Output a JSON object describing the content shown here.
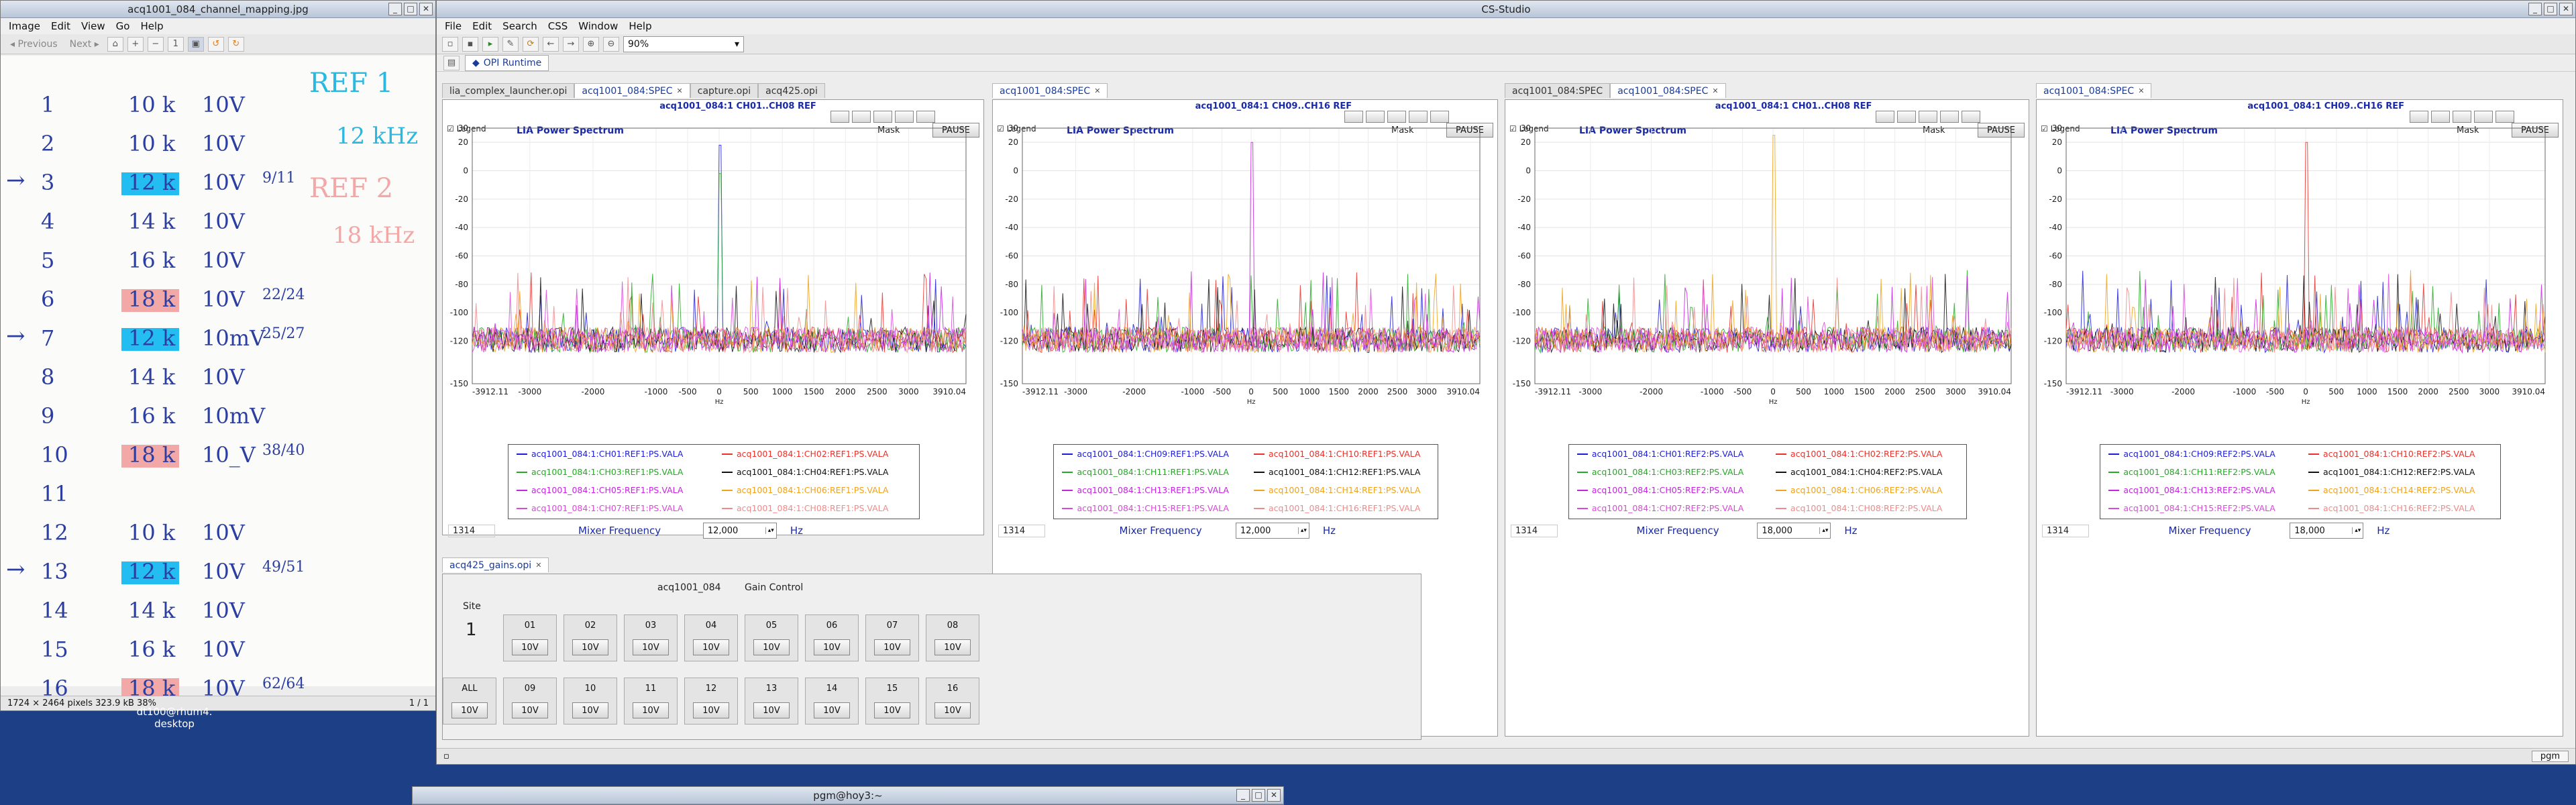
{
  "image_viewer": {
    "title": "acq1001_084_channel_mapping.jpg",
    "menu": [
      "Image",
      "Edit",
      "View",
      "Go",
      "Help"
    ],
    "nav_prev": "Previous",
    "nav_next": "Next",
    "status_left": "1724 × 2464 pixels  323.9 kB   38%",
    "status_right": "1 / 1",
    "notes": {
      "ref1": "REF 1",
      "khz12": "12 kHz",
      "ref2": "REF 2",
      "khz18": "18 kHz",
      "rows": [
        {
          "n": "1",
          "f": "10 k",
          "v": "10V",
          "x": ""
        },
        {
          "n": "2",
          "f": "10 k",
          "v": "10V",
          "x": ""
        },
        {
          "n": "3",
          "f": "12 k",
          "v": "10V",
          "x": "9/11"
        },
        {
          "n": "4",
          "f": "14 k",
          "v": "10V",
          "x": ""
        },
        {
          "n": "5",
          "f": "16 k",
          "v": "10V",
          "x": ""
        },
        {
          "n": "6",
          "f": "18 k",
          "v": "10V",
          "x": "22/24"
        },
        {
          "n": "7",
          "f": "12 k",
          "v": "10mV",
          "x": "25/27"
        },
        {
          "n": "8",
          "f": "14 k",
          "v": "10V",
          "x": ""
        },
        {
          "n": "9",
          "f": "16 k",
          "v": "10mV",
          "x": ""
        },
        {
          "n": "10",
          "f": "18 k",
          "v": "10_V",
          "x": "38/40"
        },
        {
          "n": "11",
          "f": "",
          "v": "",
          "x": ""
        },
        {
          "n": "12",
          "f": "10 k",
          "v": "10V",
          "x": ""
        },
        {
          "n": "13",
          "f": "12 k",
          "v": "10V",
          "x": "49/51"
        },
        {
          "n": "14",
          "f": "14 k",
          "v": "10V",
          "x": ""
        },
        {
          "n": "15",
          "f": "16 k",
          "v": "10V",
          "x": ""
        },
        {
          "n": "16",
          "f": "18 k",
          "v": "10V",
          "x": "62/64"
        }
      ]
    }
  },
  "desktop": {
    "host_label": "dt100@rhum4.",
    "host_label2": "desktop",
    "terminal_title": "pgm@hoy3:~"
  },
  "css": {
    "title": "CS-Studio",
    "menu": [
      "File",
      "Edit",
      "Search",
      "CSS",
      "Window",
      "Help"
    ],
    "zoom": "90%",
    "opi_runtime": "OPI Runtime",
    "status_right": "pgm",
    "tabs_left": [
      "lia_complex_launcher.opi",
      "acq1001_084:SPEC",
      "capture.opi",
      "acq425.opi"
    ],
    "gains_tab": "acq425_gains.opi",
    "panels": [
      {
        "tab": "acq1001_084:SPEC",
        "tab2": "",
        "header": "acq1001_084:1 CH01..CH08 REF",
        "mixer": "12,000",
        "low": "1314",
        "legend": [
          "acq1001_084:1:CH01:REF1:PS.VALA",
          "acq1001_084:1:CH02:REF1:PS.VALA",
          "acq1001_084:1:CH03:REF1:PS.VALA",
          "acq1001_084:1:CH04:REF1:PS.VALA",
          "acq1001_084:1:CH05:REF1:PS.VALA",
          "acq1001_084:1:CH06:REF1:PS.VALA",
          "acq1001_084:1:CH07:REF1:PS.VALA",
          "acq1001_084:1:CH08:REF1:PS.VALA"
        ]
      },
      {
        "tab": "acq1001_084:SPEC",
        "tab2": "",
        "header": "acq1001_084:1 CH09..CH16 REF",
        "mixer": "12,000",
        "low": "1314",
        "legend": [
          "acq1001_084:1:CH09:REF1:PS.VALA",
          "acq1001_084:1:CH10:REF1:PS.VALA",
          "acq1001_084:1:CH11:REF1:PS.VALA",
          "acq1001_084:1:CH12:REF1:PS.VALA",
          "acq1001_084:1:CH13:REF1:PS.VALA",
          "acq1001_084:1:CH14:REF1:PS.VALA",
          "acq1001_084:1:CH15:REF1:PS.VALA",
          "acq1001_084:1:CH16:REF1:PS.VALA"
        ]
      },
      {
        "tab": "acq1001_084:SPEC",
        "tab2": "acq1001_084:SPEC",
        "header": "acq1001_084:1 CH01..CH08 REF",
        "mixer": "18,000",
        "low": "1314",
        "legend": [
          "acq1001_084:1:CH01:REF2:PS.VALA",
          "acq1001_084:1:CH02:REF2:PS.VALA",
          "acq1001_084:1:CH03:REF2:PS.VALA",
          "acq1001_084:1:CH04:REF2:PS.VALA",
          "acq1001_084:1:CH05:REF2:PS.VALA",
          "acq1001_084:1:CH06:REF2:PS.VALA",
          "acq1001_084:1:CH07:REF2:PS.VALA",
          "acq1001_084:1:CH08:REF2:PS.VALA"
        ]
      },
      {
        "tab": "acq1001_084:SPEC",
        "tab2": "",
        "header": "acq1001_084:1 CH09..CH16 REF",
        "mixer": "18,000",
        "low": "1314",
        "legend": [
          "acq1001_084:1:CH09:REF2:PS.VALA",
          "acq1001_084:1:CH10:REF2:PS.VALA",
          "acq1001_084:1:CH11:REF2:PS.VALA",
          "acq1001_084:1:CH12:REF2:PS.VALA",
          "acq1001_084:1:CH13:REF2:PS.VALA",
          "acq1001_084:1:CH14:REF2:PS.VALA",
          "acq1001_084:1:CH15:REF2:PS.VALA",
          "acq1001_084:1:CH16:REF2:PS.VALA"
        ]
      }
    ],
    "plot_common": {
      "title": "LIA Power Spectrum",
      "legend_chk": "Legend",
      "mask": "Mask",
      "pause": "PAUSE",
      "mixer_label": "Mixer Frequency",
      "hz": "Hz",
      "xunit": "Hz"
    },
    "gains": {
      "device": "acq1001_084",
      "title": "Gain Control",
      "site_label": "Site",
      "site": "1",
      "row1": [
        "01",
        "02",
        "03",
        "04",
        "05",
        "06",
        "07",
        "08"
      ],
      "all": "ALL",
      "row2": [
        "09",
        "10",
        "11",
        "12",
        "13",
        "14",
        "15",
        "16"
      ],
      "value": "10V"
    },
    "series_colors": [
      "#1c1cd8",
      "#e8312a",
      "#24a824",
      "#111111",
      "#c424e0",
      "#f0a21c",
      "#d84ad8",
      "#f08a8a"
    ]
  },
  "chart_data": [
    {
      "type": "line",
      "title": "LIA Power Spectrum",
      "xlabel": "Hz",
      "ylabel": "",
      "xlim": [
        -3912.11,
        3910.04
      ],
      "ylim": [
        -150,
        30
      ],
      "xticks": [
        "-3912.11",
        "-3000",
        "-2000",
        "-1000",
        "-500",
        "0",
        "500",
        "1000",
        "1500",
        "2000",
        "2500",
        "3000",
        "3910.04"
      ],
      "yticks": [
        30,
        20,
        0,
        -20,
        -40,
        -60,
        -80,
        -100,
        -120,
        -150
      ],
      "series": [
        {
          "name": "acq1001_084:1:CH01:REF1:PS.VALA",
          "peaks": [
            [
              0,
              18
            ]
          ]
        },
        {
          "name": "acq1001_084:1:CH03:REF1:PS.VALA",
          "peaks": [
            [
              0,
              -2
            ]
          ]
        }
      ]
    },
    {
      "type": "line",
      "title": "LIA Power Spectrum",
      "xlabel": "Hz",
      "ylabel": "",
      "xlim": [
        -3912.11,
        3910.04
      ],
      "ylim": [
        -150,
        30
      ],
      "series": [
        {
          "name": "acq1001_084:1:CH13:REF1:PS.VALA",
          "peaks": [
            [
              0,
              20
            ]
          ]
        }
      ]
    },
    {
      "type": "line",
      "title": "LIA Power Spectrum",
      "xlabel": "Hz",
      "ylabel": "",
      "xlim": [
        -3912.11,
        3910.04
      ],
      "ylim": [
        -150,
        30
      ],
      "series": [
        {
          "name": "acq1001_084:1:CH06:REF2:PS.VALA",
          "peaks": [
            [
              0,
              25
            ]
          ]
        }
      ]
    },
    {
      "type": "line",
      "title": "LIA Power Spectrum",
      "xlabel": "Hz",
      "ylabel": "",
      "xlim": [
        -3912.11,
        3910.04
      ],
      "ylim": [
        -150,
        30
      ],
      "series": [
        {
          "name": "acq1001_084:1:CH10:REF2:PS.VALA",
          "peaks": [
            [
              0,
              20
            ]
          ]
        }
      ]
    }
  ]
}
